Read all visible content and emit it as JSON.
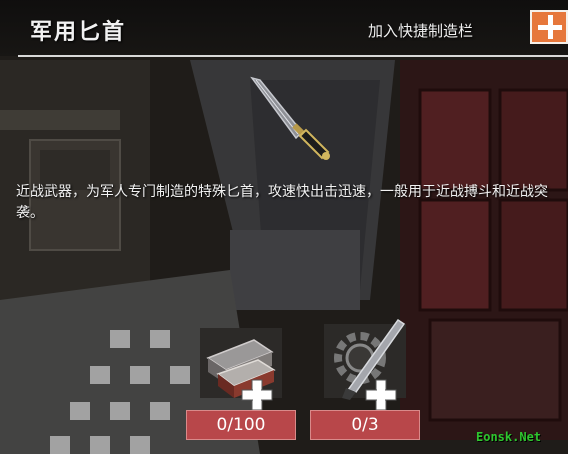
{
  "header": {
    "title": "军用匕首",
    "shortcut_label": "加入快捷制造栏"
  },
  "item": {
    "icon": "combat-knife",
    "description": "近战武器，为军人专门制造的特殊匕首，攻速快出击迅速，一般用于近战搏斗和近战突袭。"
  },
  "materials": [
    {
      "icon": "metal-ingots",
      "count": "0/100"
    },
    {
      "icon": "gear-blade-parts",
      "count": "0/3"
    }
  ],
  "colors": {
    "accent": "#e6773b",
    "count_bg": "#b8474a"
  },
  "watermark": "Eonsk.Net"
}
